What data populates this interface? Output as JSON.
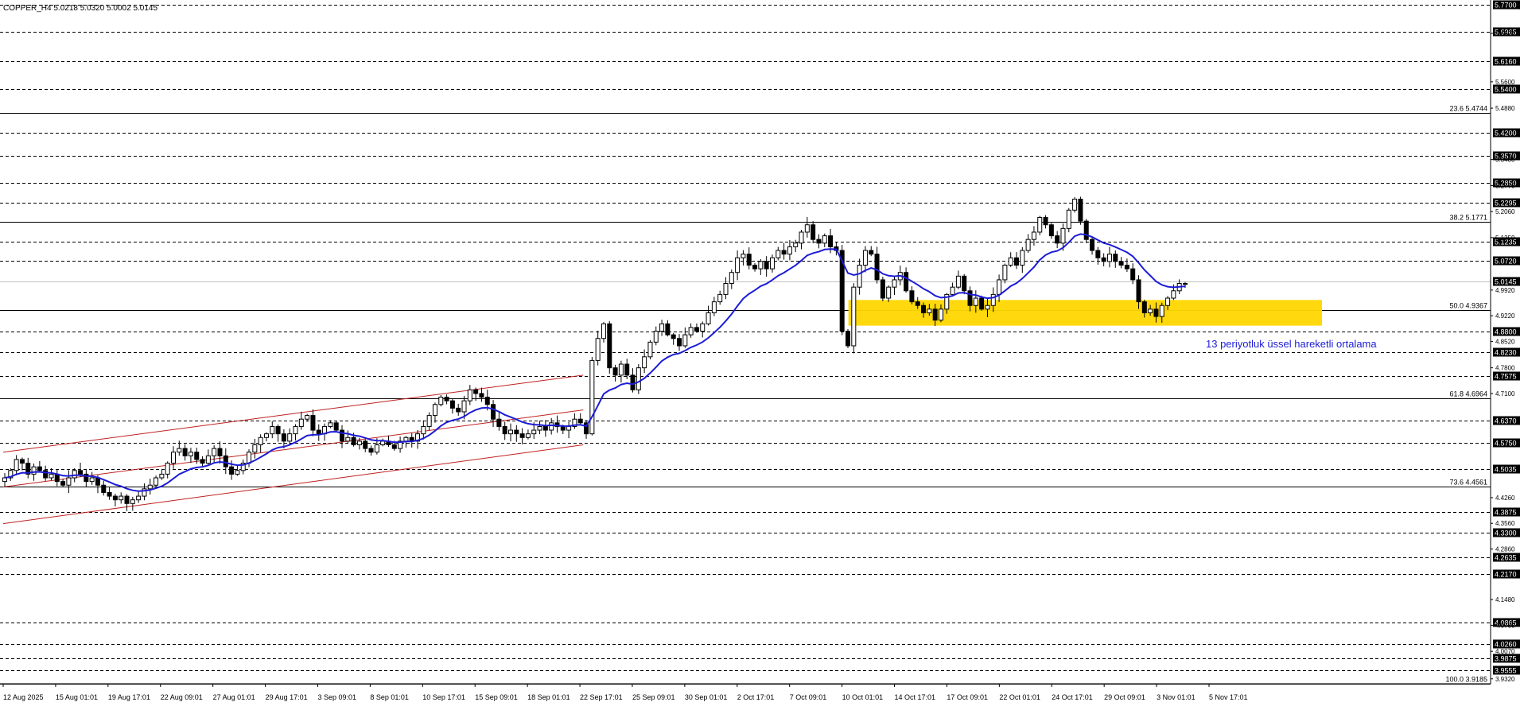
{
  "header": "COPPER_H4  5.0218 5.0320 5.0002 5.0145",
  "chart_data": {
    "type": "candlestick",
    "symbol": "COPPER",
    "timeframe": "H4",
    "ylim": [
      3.9185,
      5.77
    ],
    "x_ticks": [
      "12 Aug 2025",
      "15 Aug 01:01",
      "19 Aug 17:01",
      "22 Aug 09:01",
      "27 Aug 01:01",
      "29 Aug 17:01",
      "3 Sep 09:01",
      "8 Sep 01:01",
      "10 Sep 17:01",
      "15 Sep 09:01",
      "18 Sep 01:01",
      "22 Sep 17:01",
      "25 Sep 09:01",
      "30 Sep 01:01",
      "2 Oct 17:01",
      "7 Oct 09:01",
      "10 Oct 01:01",
      "14 Oct 17:01",
      "17 Oct 09:01",
      "22 Oct 01:01",
      "24 Oct 17:01",
      "29 Oct 09:01",
      "3 Nov 01:01",
      "5 Nov 17:01"
    ],
    "levels": [
      "5.7700",
      "5.6965",
      "5.6160",
      "5.5400",
      "5.4200",
      "5.3570",
      "5.2850",
      "5.2295",
      "5.1235",
      "5.0720",
      "5.0145",
      "4.8800",
      "4.8230",
      "4.7575",
      "4.6370",
      "4.5750",
      "4.5035",
      "4.3875",
      "4.3300",
      "4.2635",
      "4.2170",
      "4.0865",
      "4.0260",
      "3.9875",
      "3.9555"
    ],
    "minor_ticks": [
      "5.6920",
      "5.5600",
      "5.4880",
      "5.3480",
      "5.2770",
      "5.2060",
      "5.1350",
      "4.9920",
      "4.9220",
      "4.8520",
      "4.7800",
      "4.7100",
      "4.4260",
      "4.3560",
      "4.2860",
      "4.1480",
      "4.0780",
      "4.0070",
      "3.9320"
    ],
    "fib_levels": [
      {
        "label": "23.6 5.4744",
        "value": 5.4744
      },
      {
        "label": "38.2 5.1771",
        "value": 5.1771
      },
      {
        "label": "50.0 4.9367",
        "value": 4.9367
      },
      {
        "label": "61.8 4.6964",
        "value": 4.6964
      },
      {
        "label": "73.6 4.4561",
        "value": 4.4561
      },
      {
        "label": "100.0 3.9185",
        "value": 3.9185
      }
    ],
    "current_price": "5.0145",
    "zone": {
      "from_label": "10 Oct 01:01",
      "to_label": "5 Nov 17:01",
      "low": 4.895,
      "high": 4.965,
      "color": "#FFD700"
    },
    "ema_label": "13 periyotluk üssel hareketli ortalama",
    "ema_period": 13,
    "colors": {
      "ema": "#1c1cd6",
      "channel": "#c02020",
      "zone": "#FFD700",
      "candle": "#000000"
    },
    "channel": {
      "upper": [
        [
          0,
          4.55
        ],
        [
          0.39,
          4.76
        ]
      ],
      "middle": [
        [
          0,
          4.455
        ],
        [
          0.39,
          4.665
        ]
      ],
      "lower": [
        [
          0,
          4.355
        ],
        [
          0.39,
          4.57
        ]
      ]
    },
    "closes": [
      4.48,
      4.5,
      4.53,
      4.52,
      4.49,
      4.51,
      4.5,
      4.48,
      4.49,
      4.47,
      4.46,
      4.48,
      4.5,
      4.49,
      4.47,
      4.48,
      4.46,
      4.44,
      4.43,
      4.42,
      4.43,
      4.41,
      4.42,
      4.43,
      4.45,
      4.46,
      4.48,
      4.49,
      4.52,
      4.55,
      4.56,
      4.54,
      4.55,
      4.53,
      4.52,
      4.54,
      4.56,
      4.54,
      4.51,
      4.49,
      4.5,
      4.52,
      4.55,
      4.57,
      4.59,
      4.6,
      4.62,
      4.6,
      4.58,
      4.6,
      4.62,
      4.64,
      4.65,
      4.61,
      4.6,
      4.62,
      4.63,
      4.61,
      4.58,
      4.59,
      4.57,
      4.58,
      4.56,
      4.55,
      4.57,
      4.58,
      4.57,
      4.56,
      4.58,
      4.59,
      4.58,
      4.6,
      4.62,
      4.65,
      4.68,
      4.7,
      4.69,
      4.67,
      4.66,
      4.69,
      4.72,
      4.71,
      4.7,
      4.68,
      4.64,
      4.62,
      4.6,
      4.61,
      4.6,
      4.59,
      4.6,
      4.61,
      4.62,
      4.61,
      4.63,
      4.62,
      4.61,
      4.62,
      4.64,
      4.63,
      4.6,
      4.8,
      4.86,
      4.9,
      4.78,
      4.76,
      4.79,
      4.76,
      4.72,
      4.78,
      4.81,
      4.85,
      4.88,
      4.9,
      4.87,
      4.86,
      4.84,
      4.87,
      4.89,
      4.88,
      4.9,
      4.93,
      4.96,
      4.98,
      5.01,
      5.04,
      5.08,
      5.09,
      5.06,
      5.05,
      5.07,
      5.05,
      5.08,
      5.1,
      5.09,
      5.11,
      5.12,
      5.15,
      5.17,
      5.13,
      5.12,
      5.14,
      5.11,
      5.1,
      4.88,
      4.84,
      5.0,
      5.06,
      5.1,
      5.09,
      5.02,
      4.97,
      5.0,
      5.02,
      5.04,
      4.99,
      4.96,
      4.95,
      4.93,
      4.94,
      4.91,
      4.94,
      4.98,
      5.0,
      5.03,
      4.99,
      4.95,
      4.97,
      4.94,
      4.95,
      4.98,
      5.02,
      5.06,
      5.08,
      5.06,
      5.1,
      5.13,
      5.15,
      5.19,
      5.17,
      5.14,
      5.12,
      5.16,
      5.21,
      5.24,
      5.18,
      5.13,
      5.1,
      5.08,
      5.07,
      5.09,
      5.07,
      5.06,
      5.05,
      5.02,
      4.96,
      4.93,
      4.94,
      4.92,
      4.95,
      4.97,
      4.99,
      5.01,
      5.01
    ]
  }
}
